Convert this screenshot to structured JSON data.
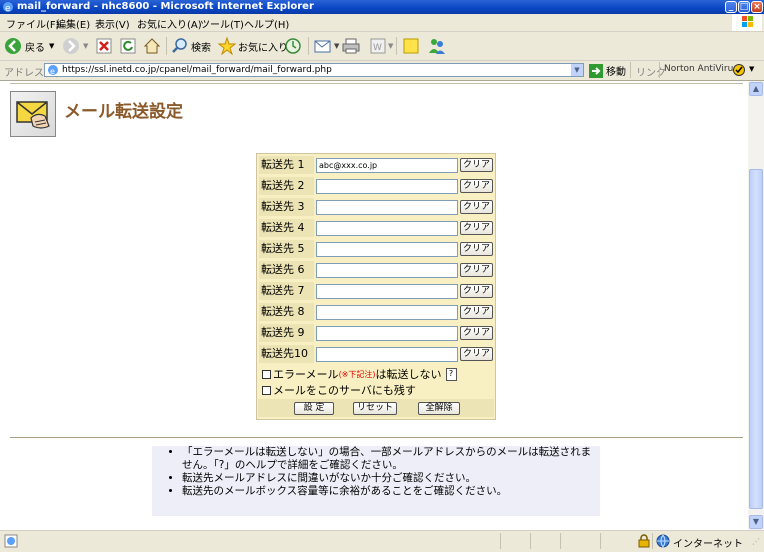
{
  "window": {
    "title": "mail_forward - nhc8600 - Microsoft Internet Explorer"
  },
  "menu": [
    "ファイル(F)",
    "編集(E)",
    "表示(V)",
    "お気に入り(A)",
    "ツール(T)",
    "ヘルプ(H)"
  ],
  "toolbar": {
    "back": "戻る",
    "search": "検索",
    "favorites": "お気に入り"
  },
  "address": {
    "label": "アドレス(D)",
    "url": "https://ssl.inetd.co.jp/cpanel/mail_forward/mail_forward.php",
    "go": "移動",
    "links": "リンク",
    "antivirus": "Norton AntiVirus"
  },
  "page": {
    "title": "メール転送設定"
  },
  "form": {
    "rows": [
      {
        "label": "転送先 1",
        "value": "abc@xxx.co.jp"
      },
      {
        "label": "転送先 2",
        "value": ""
      },
      {
        "label": "転送先 3",
        "value": ""
      },
      {
        "label": "転送先 4",
        "value": ""
      },
      {
        "label": "転送先 5",
        "value": ""
      },
      {
        "label": "転送先 6",
        "value": ""
      },
      {
        "label": "転送先 7",
        "value": ""
      },
      {
        "label": "転送先 8",
        "value": ""
      },
      {
        "label": "転送先 9",
        "value": ""
      },
      {
        "label": "転送先10",
        "value": ""
      }
    ],
    "clear_label": "クリア",
    "opt_error_pre": "エラーメール",
    "opt_error_note": "(※下記注)",
    "opt_error_post": "は転送しない",
    "help": "?",
    "opt_keep": "メールをこのサーバにも残す",
    "btn_set": "設 定",
    "btn_reset": "リセット",
    "btn_clear_all": "全解除"
  },
  "notes": [
    "「エラーメールは転送しない」の場合、一部メールアドレスからのメールは転送されません。「?」のヘルプで詳細をご確認ください。",
    "転送先メールアドレスに間違いがないか十分ご確認ください。",
    "転送先のメールボックス容量等に余裕があることをご確認ください。"
  ],
  "status": {
    "zone": "インターネット"
  }
}
